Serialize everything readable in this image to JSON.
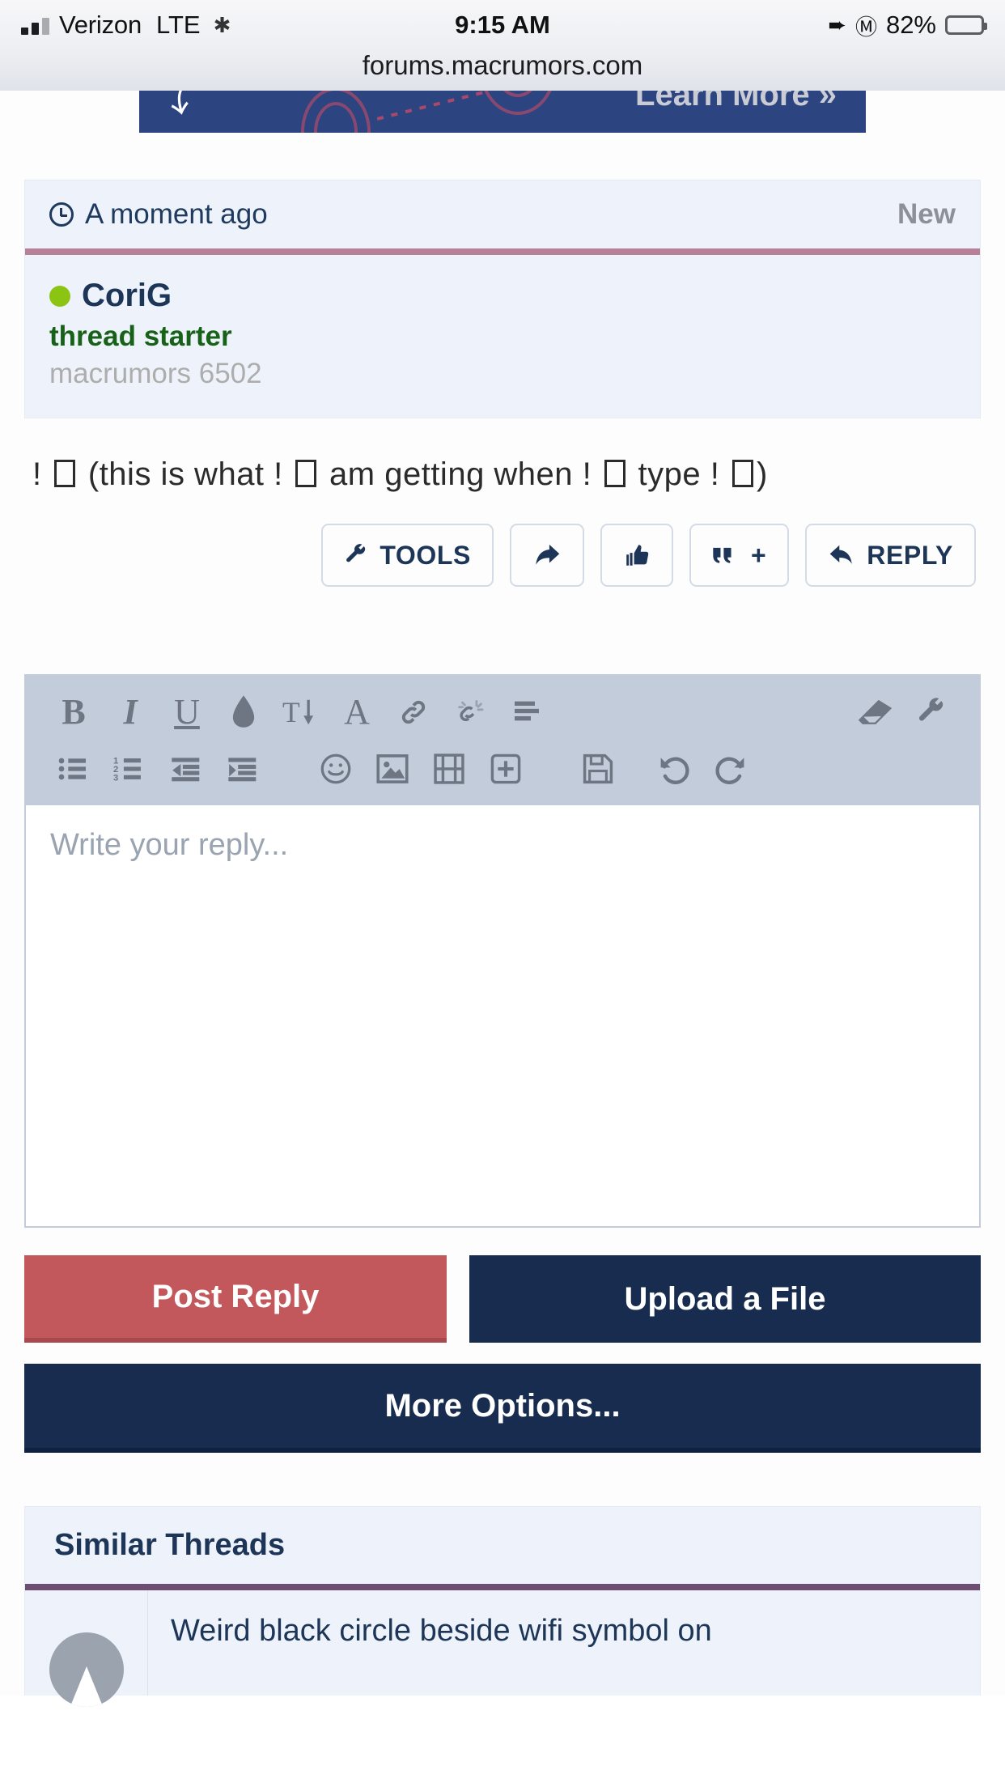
{
  "status_bar": {
    "carrier": "Verizon",
    "network": "LTE",
    "sync_icon": "spinner-icon",
    "time": "9:15 AM",
    "location_icon": "location-arrow-icon",
    "bluetooth_icon": "bluetooth-icon",
    "battery_percent": "82%",
    "battery_level": 82
  },
  "browser": {
    "url": "forums.macrumors.com"
  },
  "promo_banner": {
    "cta": "Learn More »",
    "icon": "curved-arrow-icon",
    "background": "#2c4480",
    "accent": "#a8496b"
  },
  "post": {
    "timestamp": "A moment ago",
    "clock_icon": "clock-icon",
    "status_label": "New",
    "rule_color": "#b88099",
    "author": {
      "name": "CoriG",
      "online_indicator": "online-dot",
      "online_color": "#8cc413",
      "role": "thread starter",
      "rank": "macrumors 6502"
    },
    "body_parts": [
      {
        "type": "text",
        "value": "!"
      },
      {
        "type": "tofu"
      },
      {
        "type": "text",
        "value": "(this is what !"
      },
      {
        "type": "tofu"
      },
      {
        "type": "text",
        "value": "am getting when !"
      },
      {
        "type": "tofu"
      },
      {
        "type": "text",
        "value": "type !"
      },
      {
        "type": "tofu"
      },
      {
        "type": "text",
        "value": ")"
      }
    ],
    "body_text": "! □ (this is what ! □ am getting when ! □ type ! □)",
    "actions": [
      {
        "name": "tools-button",
        "label": "TOOLS",
        "icon": "wrench-icon"
      },
      {
        "name": "share-button",
        "label": "",
        "icon": "share-arrow-icon"
      },
      {
        "name": "like-button",
        "label": "",
        "icon": "thumbs-up-icon"
      },
      {
        "name": "quote-button",
        "label": "+",
        "icon": "quote-icon"
      },
      {
        "name": "reply-button",
        "label": "REPLY",
        "icon": "reply-arrow-icon"
      }
    ]
  },
  "editor": {
    "placeholder": "Write your reply...",
    "toolbar_row_1": [
      {
        "name": "bold-icon",
        "glyph": "B"
      },
      {
        "name": "italic-icon",
        "glyph": "I"
      },
      {
        "name": "underline-icon",
        "glyph": "U"
      },
      {
        "name": "text-color-icon",
        "glyph": "droplet"
      },
      {
        "name": "font-size-icon",
        "glyph": "T↓"
      },
      {
        "name": "font-family-icon",
        "glyph": "A"
      },
      {
        "name": "insert-link-icon",
        "glyph": "link"
      },
      {
        "name": "remove-link-icon",
        "glyph": "unlink"
      },
      {
        "name": "text-align-icon",
        "glyph": "align"
      }
    ],
    "toolbar_row_1_right": [
      {
        "name": "eraser-icon",
        "glyph": "eraser"
      },
      {
        "name": "editor-tools-icon",
        "glyph": "wrench"
      }
    ],
    "toolbar_row_2": [
      {
        "name": "bullet-list-icon",
        "glyph": "ul"
      },
      {
        "name": "numbered-list-icon",
        "glyph": "ol"
      },
      {
        "name": "outdent-icon",
        "glyph": "outdent"
      },
      {
        "name": "indent-icon",
        "glyph": "indent"
      },
      {
        "name": "emoji-icon",
        "glyph": "smiley"
      },
      {
        "name": "insert-image-icon",
        "glyph": "image"
      },
      {
        "name": "insert-media-icon",
        "glyph": "film"
      },
      {
        "name": "insert-more-icon",
        "glyph": "plus-box"
      },
      {
        "name": "save-draft-icon",
        "glyph": "floppy"
      },
      {
        "name": "undo-icon",
        "glyph": "undo"
      },
      {
        "name": "redo-icon",
        "glyph": "redo"
      }
    ]
  },
  "submit": {
    "post_reply": "Post Reply",
    "post_reply_color": "#c2585b",
    "upload_file": "Upload a File",
    "upload_file_color": "#172c4f",
    "more_options": "More Options..."
  },
  "similar_threads": {
    "heading": "Similar Threads",
    "rule_color": "#6f4e73",
    "items": [
      {
        "title": "Weird black circle beside wifi symbol on",
        "avatar": "default-avatar"
      }
    ]
  }
}
